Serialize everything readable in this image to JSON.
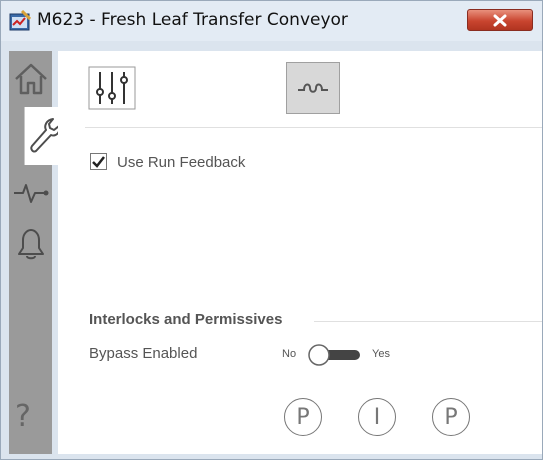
{
  "window": {
    "title": "M623 - Fresh Leaf Transfer Conveyor",
    "close_icon": "close-icon"
  },
  "sidebar": {
    "tabs": [
      {
        "name": "home",
        "icon": "home-icon",
        "active": false
      },
      {
        "name": "maintenance",
        "icon": "wrench-icon",
        "active": true
      },
      {
        "name": "trends",
        "icon": "trend-icon",
        "active": false
      },
      {
        "name": "alarms",
        "icon": "bell-icon",
        "active": false
      }
    ],
    "help_label": "?"
  },
  "toolbar": {
    "buttons": [
      {
        "icon": "sliders-icon",
        "selected": false
      },
      {
        "icon": "bypass-icon",
        "selected": true
      }
    ]
  },
  "options": {
    "use_run_feedback": {
      "label": "Use Run Feedback",
      "checked": true
    }
  },
  "interlocks": {
    "section_title": "Interlocks and Permissives",
    "bypass_label": "Bypass Enabled",
    "toggle_off_label": "No",
    "toggle_on_label": "Yes",
    "toggle_state": "No"
  },
  "bottom_buttons": [
    {
      "label": "P",
      "name": "permissive"
    },
    {
      "label": "I",
      "name": "interlock"
    },
    {
      "label": "P",
      "name": "permissive"
    }
  ],
  "colors": {
    "titlebar": "#e3ebf4",
    "sidebar": "#9a9a9a",
    "close_red": "#c9452f",
    "text_gray": "#555555"
  }
}
